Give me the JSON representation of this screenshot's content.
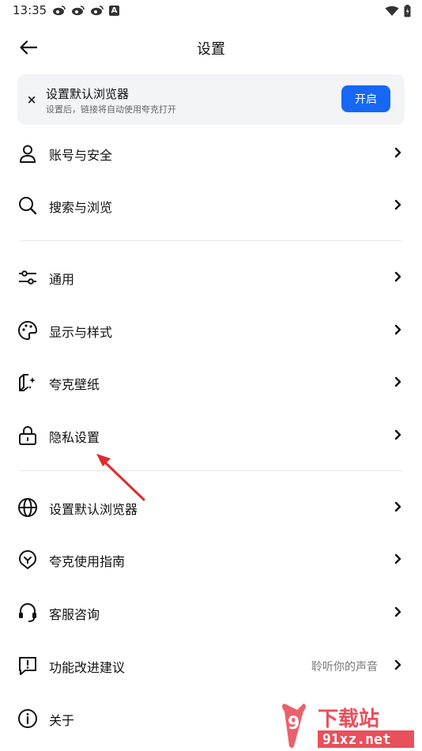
{
  "status_bar": {
    "time": "13:35",
    "notification_icons": [
      "weibo-icon",
      "weibo-icon",
      "weibo-icon",
      "a-icon"
    ],
    "a_icon_label": "A"
  },
  "header": {
    "title": "设置"
  },
  "banner": {
    "close_symbol": "×",
    "title": "设置默认浏览器",
    "subtitle": "设置后，链接将自动使用夸克打开",
    "button_label": "开启",
    "accent_color": "#1668f4"
  },
  "menu": {
    "items": [
      {
        "label": "账号与安全",
        "icon": "user-icon"
      },
      {
        "label": "搜索与浏览",
        "icon": "search-icon"
      },
      {
        "label": "通用",
        "icon": "sliders-icon"
      },
      {
        "label": "显示与样式",
        "icon": "palette-icon"
      },
      {
        "label": "夸克壁纸",
        "icon": "wallpaper-icon"
      },
      {
        "label": "隐私设置",
        "icon": "lock-icon"
      },
      {
        "label": "设置默认浏览器",
        "icon": "globe-icon"
      },
      {
        "label": "夸克使用指南",
        "icon": "guide-icon"
      },
      {
        "label": "客服咨询",
        "icon": "headset-icon"
      },
      {
        "label": "功能改进建议",
        "icon": "feedback-icon",
        "hint": "聆听你的声音"
      },
      {
        "label": "关于",
        "icon": "info-icon"
      }
    ]
  },
  "watermark": {
    "text_top": "下载站",
    "text_bottom": "91xz.net",
    "logo_text": "9"
  }
}
